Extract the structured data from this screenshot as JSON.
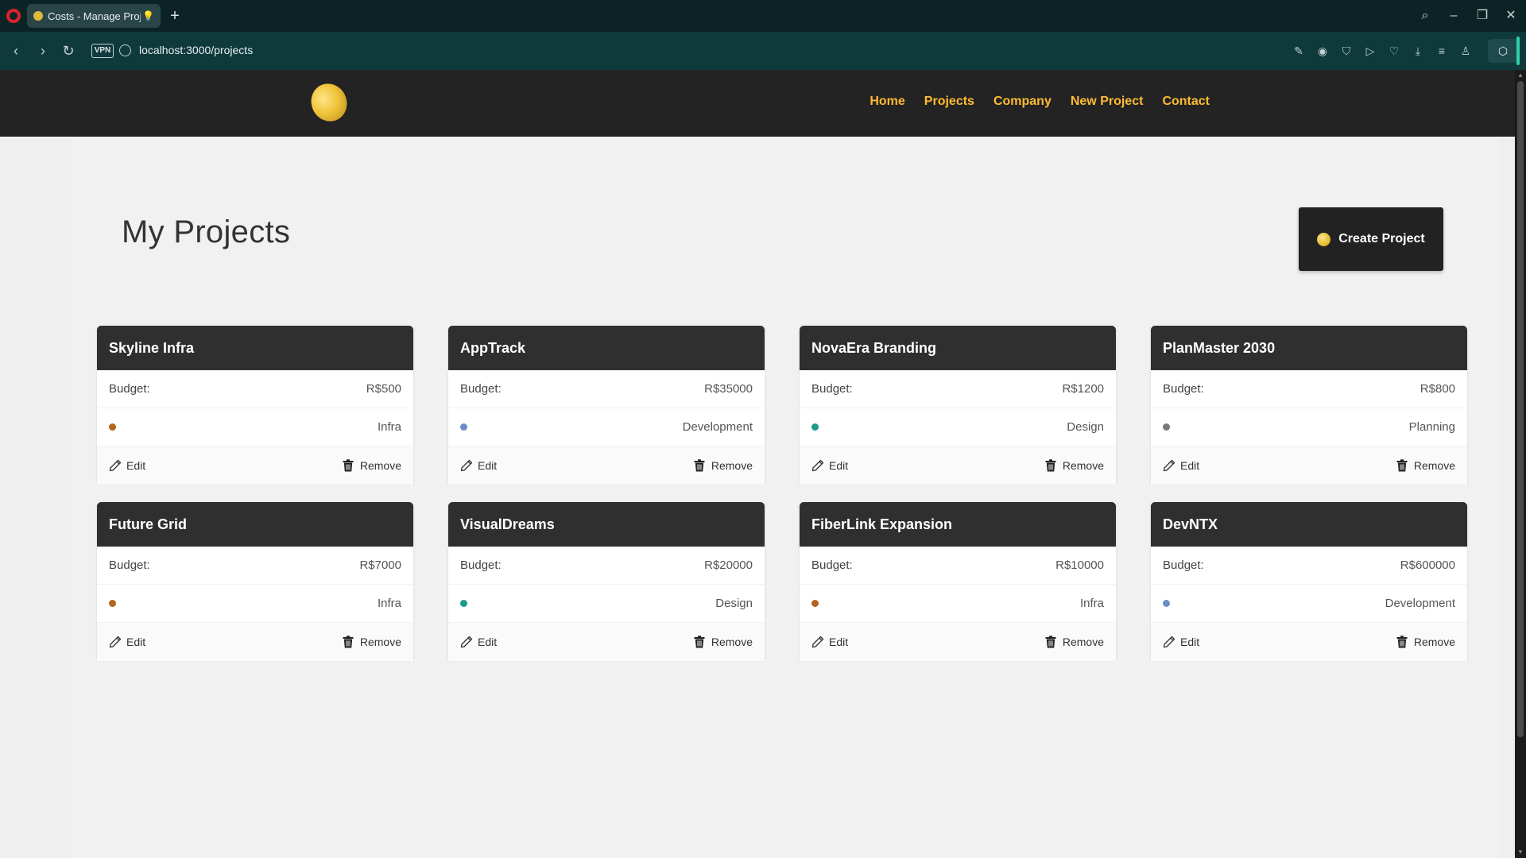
{
  "browser": {
    "tab_title": "Costs - Manage Projects",
    "tab_bulb": "💡",
    "url": "localhost:3000/projects",
    "vpn_label": "VPN"
  },
  "navbar": {
    "links": [
      "Home",
      "Projects",
      "Company",
      "New Project",
      "Contact"
    ],
    "link_color": "#ffbb33"
  },
  "page": {
    "title": "My Projects",
    "create_button_label": "Create Project"
  },
  "category_colors": {
    "Infra": "#b5651d",
    "Development": "#6b8ec6",
    "Design": "#1a9a8a",
    "Planning": "#7a7a7a"
  },
  "card_labels": {
    "budget": "Budget:",
    "edit": "Edit",
    "remove": "Remove"
  },
  "projects": [
    {
      "name": "Skyline Infra",
      "budget": "R$500",
      "category": "Infra",
      "dot_color": "#b5651d"
    },
    {
      "name": "AppTrack",
      "budget": "R$35000",
      "category": "Development",
      "dot_color": "#6b8ec6"
    },
    {
      "name": "NovaEra Branding",
      "budget": "R$1200",
      "category": "Design",
      "dot_color": "#1a9a8a"
    },
    {
      "name": "PlanMaster 2030",
      "budget": "R$800",
      "category": "Planning",
      "dot_color": "#7a7a7a"
    },
    {
      "name": "Future Grid",
      "budget": "R$7000",
      "category": "Infra",
      "dot_color": "#b5651d"
    },
    {
      "name": "VisualDreams",
      "budget": "R$20000",
      "category": "Design",
      "dot_color": "#1a9a8a"
    },
    {
      "name": "FiberLink Expansion",
      "budget": "R$10000",
      "category": "Infra",
      "dot_color": "#b5651d"
    },
    {
      "name": "DevNTX",
      "budget": "R$600000",
      "category": "Development",
      "dot_color": "#6b8ec6"
    }
  ]
}
